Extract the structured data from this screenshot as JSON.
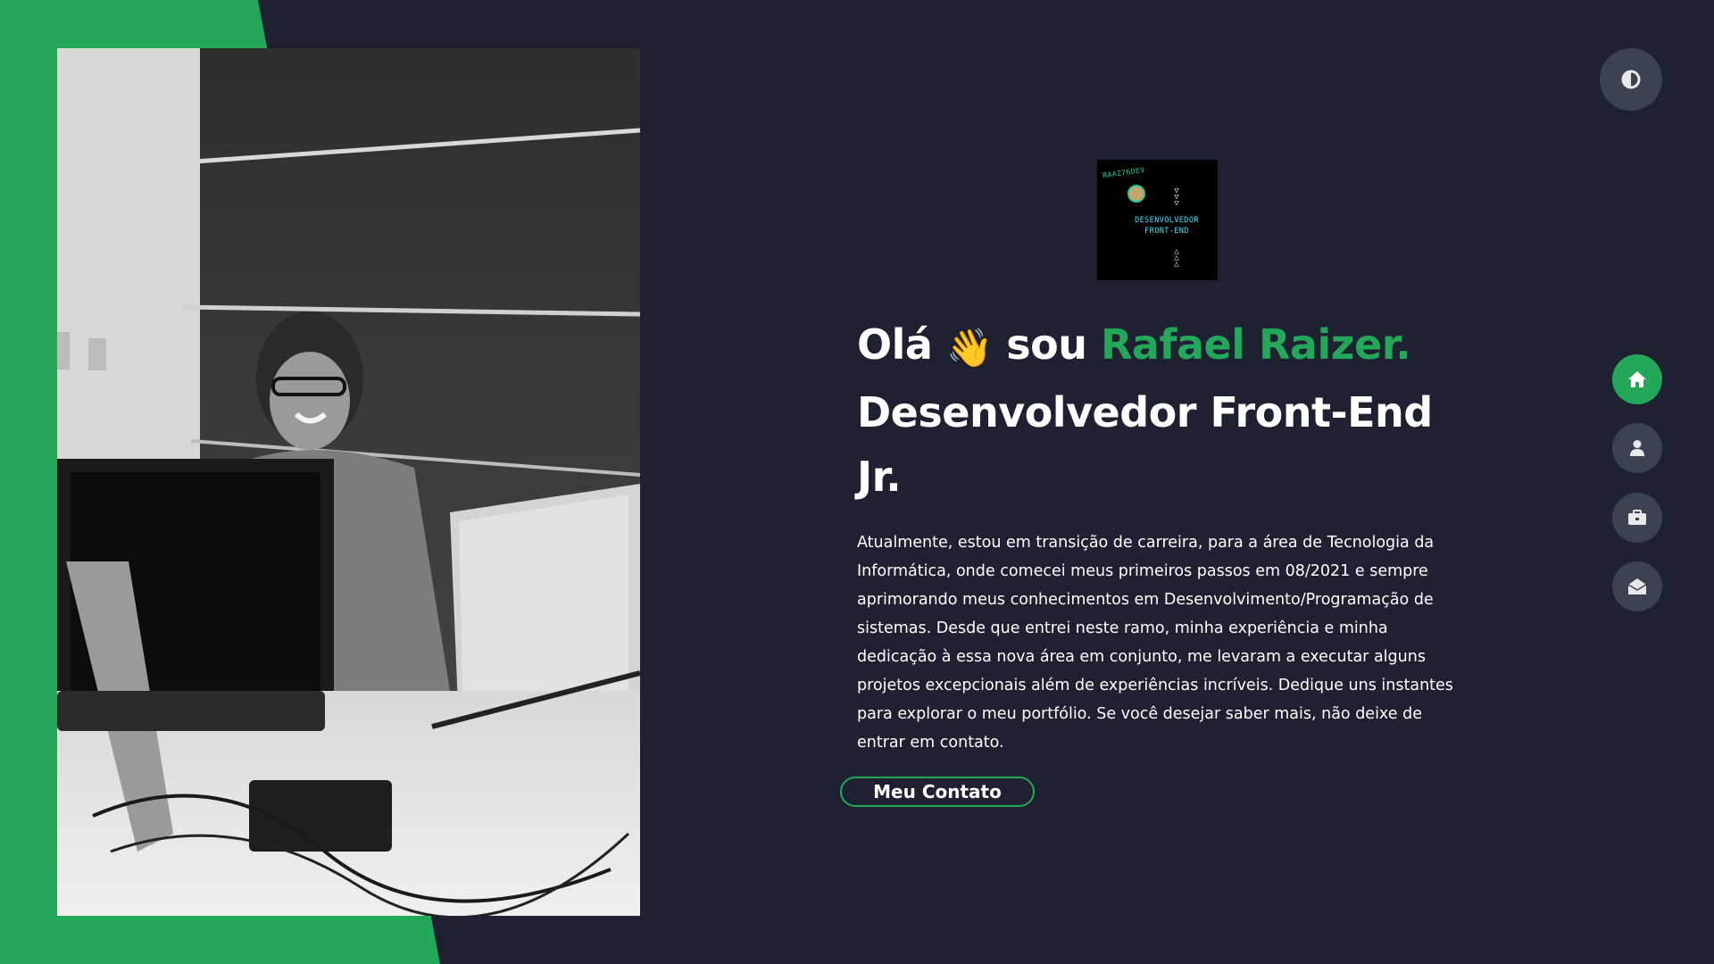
{
  "logo": {
    "brand_text": "RAAZ76DEV",
    "subtitle_line1": "DESENVOLVEDOR",
    "subtitle_line2": "FRONT-END"
  },
  "hero": {
    "greeting": "Olá",
    "wave_emoji": "👋",
    "intro": "sou",
    "name": "Rafael Raizer.",
    "role": "Desenvolvedor Front-End Jr.",
    "description": "Atualmente, estou em transição de carreira, para a área de Tecnologia da Informática, onde comecei meus primeiros passos em 08/2021 e sempre aprimorando meus conhecimentos em Desenvolvimento/Programação de sistemas. Desde que entrei neste ramo, minha experiência e minha dedicação à essa nova área em conjunto, me levaram a executar alguns projetos excepcionais além de experiências incríveis. Dedique uns instantes para explorar o meu portfólio. Se você desejar saber mais, não deixe de entrar em contato.",
    "contact_button": "Meu Contato"
  },
  "controls": {
    "theme_toggle_icon": "half-circle-contrast-icon"
  },
  "nav": {
    "items": [
      {
        "icon": "home-icon",
        "active": true
      },
      {
        "icon": "user-icon",
        "active": false
      },
      {
        "icon": "briefcase-icon",
        "active": false
      },
      {
        "icon": "envelope-open-icon",
        "active": false
      }
    ]
  },
  "colors": {
    "background": "#1d2132",
    "accent": "#23a85a",
    "button_gray": "#3d4252",
    "text": "#ffffff"
  }
}
